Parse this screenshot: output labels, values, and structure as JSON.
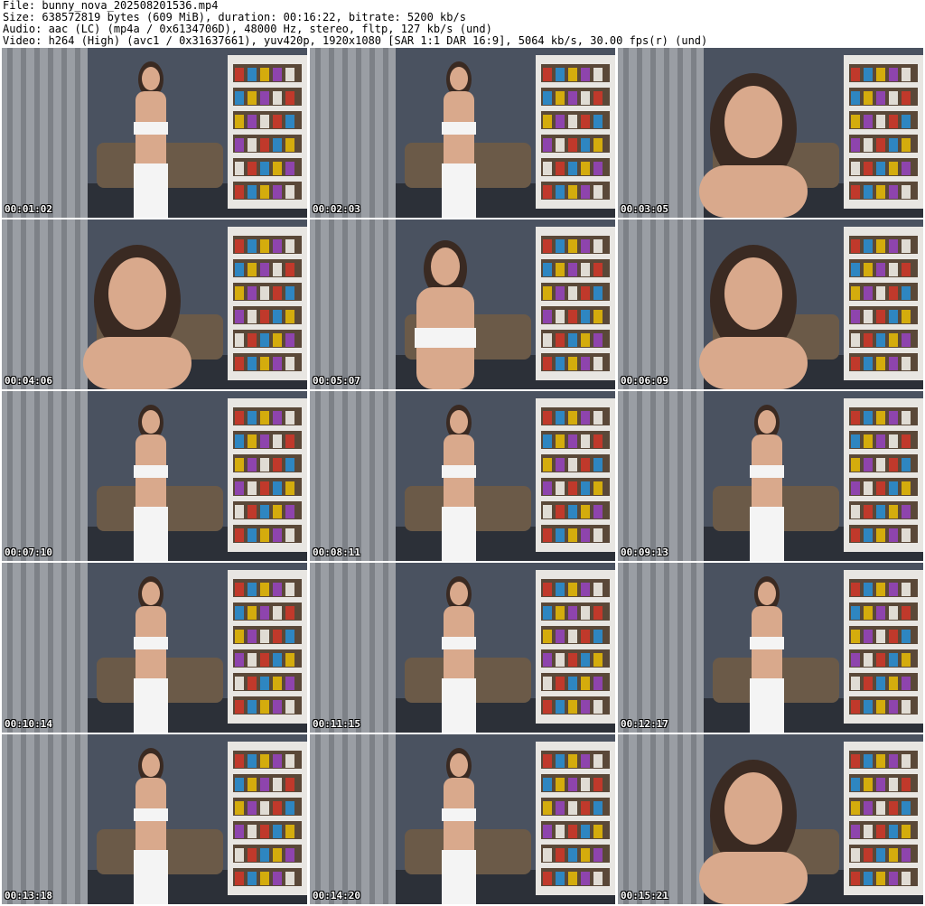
{
  "header": {
    "file": "File: bunny_nova_202508201536.mp4",
    "size": "Size: 638572819 bytes (609 MiB), duration: 00:16:22, bitrate: 5200 kb/s",
    "audio": "Audio: aac (LC) (mp4a / 0x6134706D), 48000 Hz, stereo, fltp, 127 kb/s (und)",
    "video": "Video: h264 (High) (avc1 / 0x31637661), yuv420p, 1920x1080 [SAR 1:1 DAR 16:9], 5064 kb/s, 30.00 fps(r) (und)"
  },
  "thumbnails": [
    {
      "timestamp": "00:01:02",
      "shot": "full"
    },
    {
      "timestamp": "00:02:03",
      "shot": "full"
    },
    {
      "timestamp": "00:03:05",
      "shot": "close"
    },
    {
      "timestamp": "00:04:06",
      "shot": "close"
    },
    {
      "timestamp": "00:05:07",
      "shot": "mid"
    },
    {
      "timestamp": "00:06:09",
      "shot": "close"
    },
    {
      "timestamp": "00:07:10",
      "shot": "full"
    },
    {
      "timestamp": "00:08:11",
      "shot": "full"
    },
    {
      "timestamp": "00:09:13",
      "shot": "full"
    },
    {
      "timestamp": "00:10:14",
      "shot": "full"
    },
    {
      "timestamp": "00:11:15",
      "shot": "full"
    },
    {
      "timestamp": "00:12:17",
      "shot": "full"
    },
    {
      "timestamp": "00:13:18",
      "shot": "full"
    },
    {
      "timestamp": "00:14:20",
      "shot": "full"
    },
    {
      "timestamp": "00:15:21",
      "shot": "close"
    }
  ]
}
